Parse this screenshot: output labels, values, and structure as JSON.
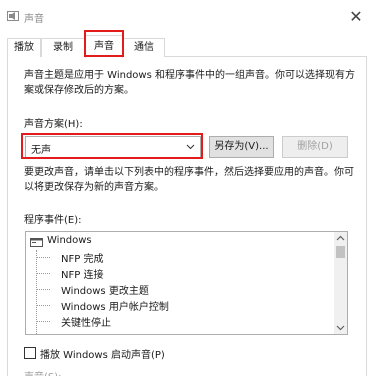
{
  "window": {
    "title": "声音",
    "close_glyph": "✕"
  },
  "tabs": [
    {
      "label": "播放"
    },
    {
      "label": "录制"
    },
    {
      "label": "声音"
    },
    {
      "label": "通信"
    }
  ],
  "sounds_page": {
    "intro_line1": "声音主题是应用于 Windows 和程序事件中的一组声音。你可以选择现有方",
    "intro_line2": "案或保存修改后的方案。",
    "scheme_label": "声音方案(H):",
    "scheme_value": "无声",
    "save_as_label": "另存为(V)...",
    "delete_label": "删除(D)",
    "change_line1": "要更改声音，请单击以下列表中的程序事件，然后选择要应用的声音。你可",
    "change_line2": "以将更改保存为新的声音方案。",
    "events_label": "程序事件(E):",
    "events_root": "Windows",
    "events": [
      {
        "label": "NFP 完成"
      },
      {
        "label": "NFP 连接"
      },
      {
        "label": "Windows 更改主题"
      },
      {
        "label": "Windows 用户帐户控制"
      },
      {
        "label": "关键性停止"
      }
    ],
    "startup_sound_label": "播放 Windows 启动声音(P)",
    "startup_sound_checked": false,
    "sound_field_label": "声音(S):"
  },
  "colors": {
    "highlight_red": "#e21b1b",
    "button_face": "#e1e1e1",
    "border": "#adadad",
    "disabled_text": "#a0a0a0"
  }
}
